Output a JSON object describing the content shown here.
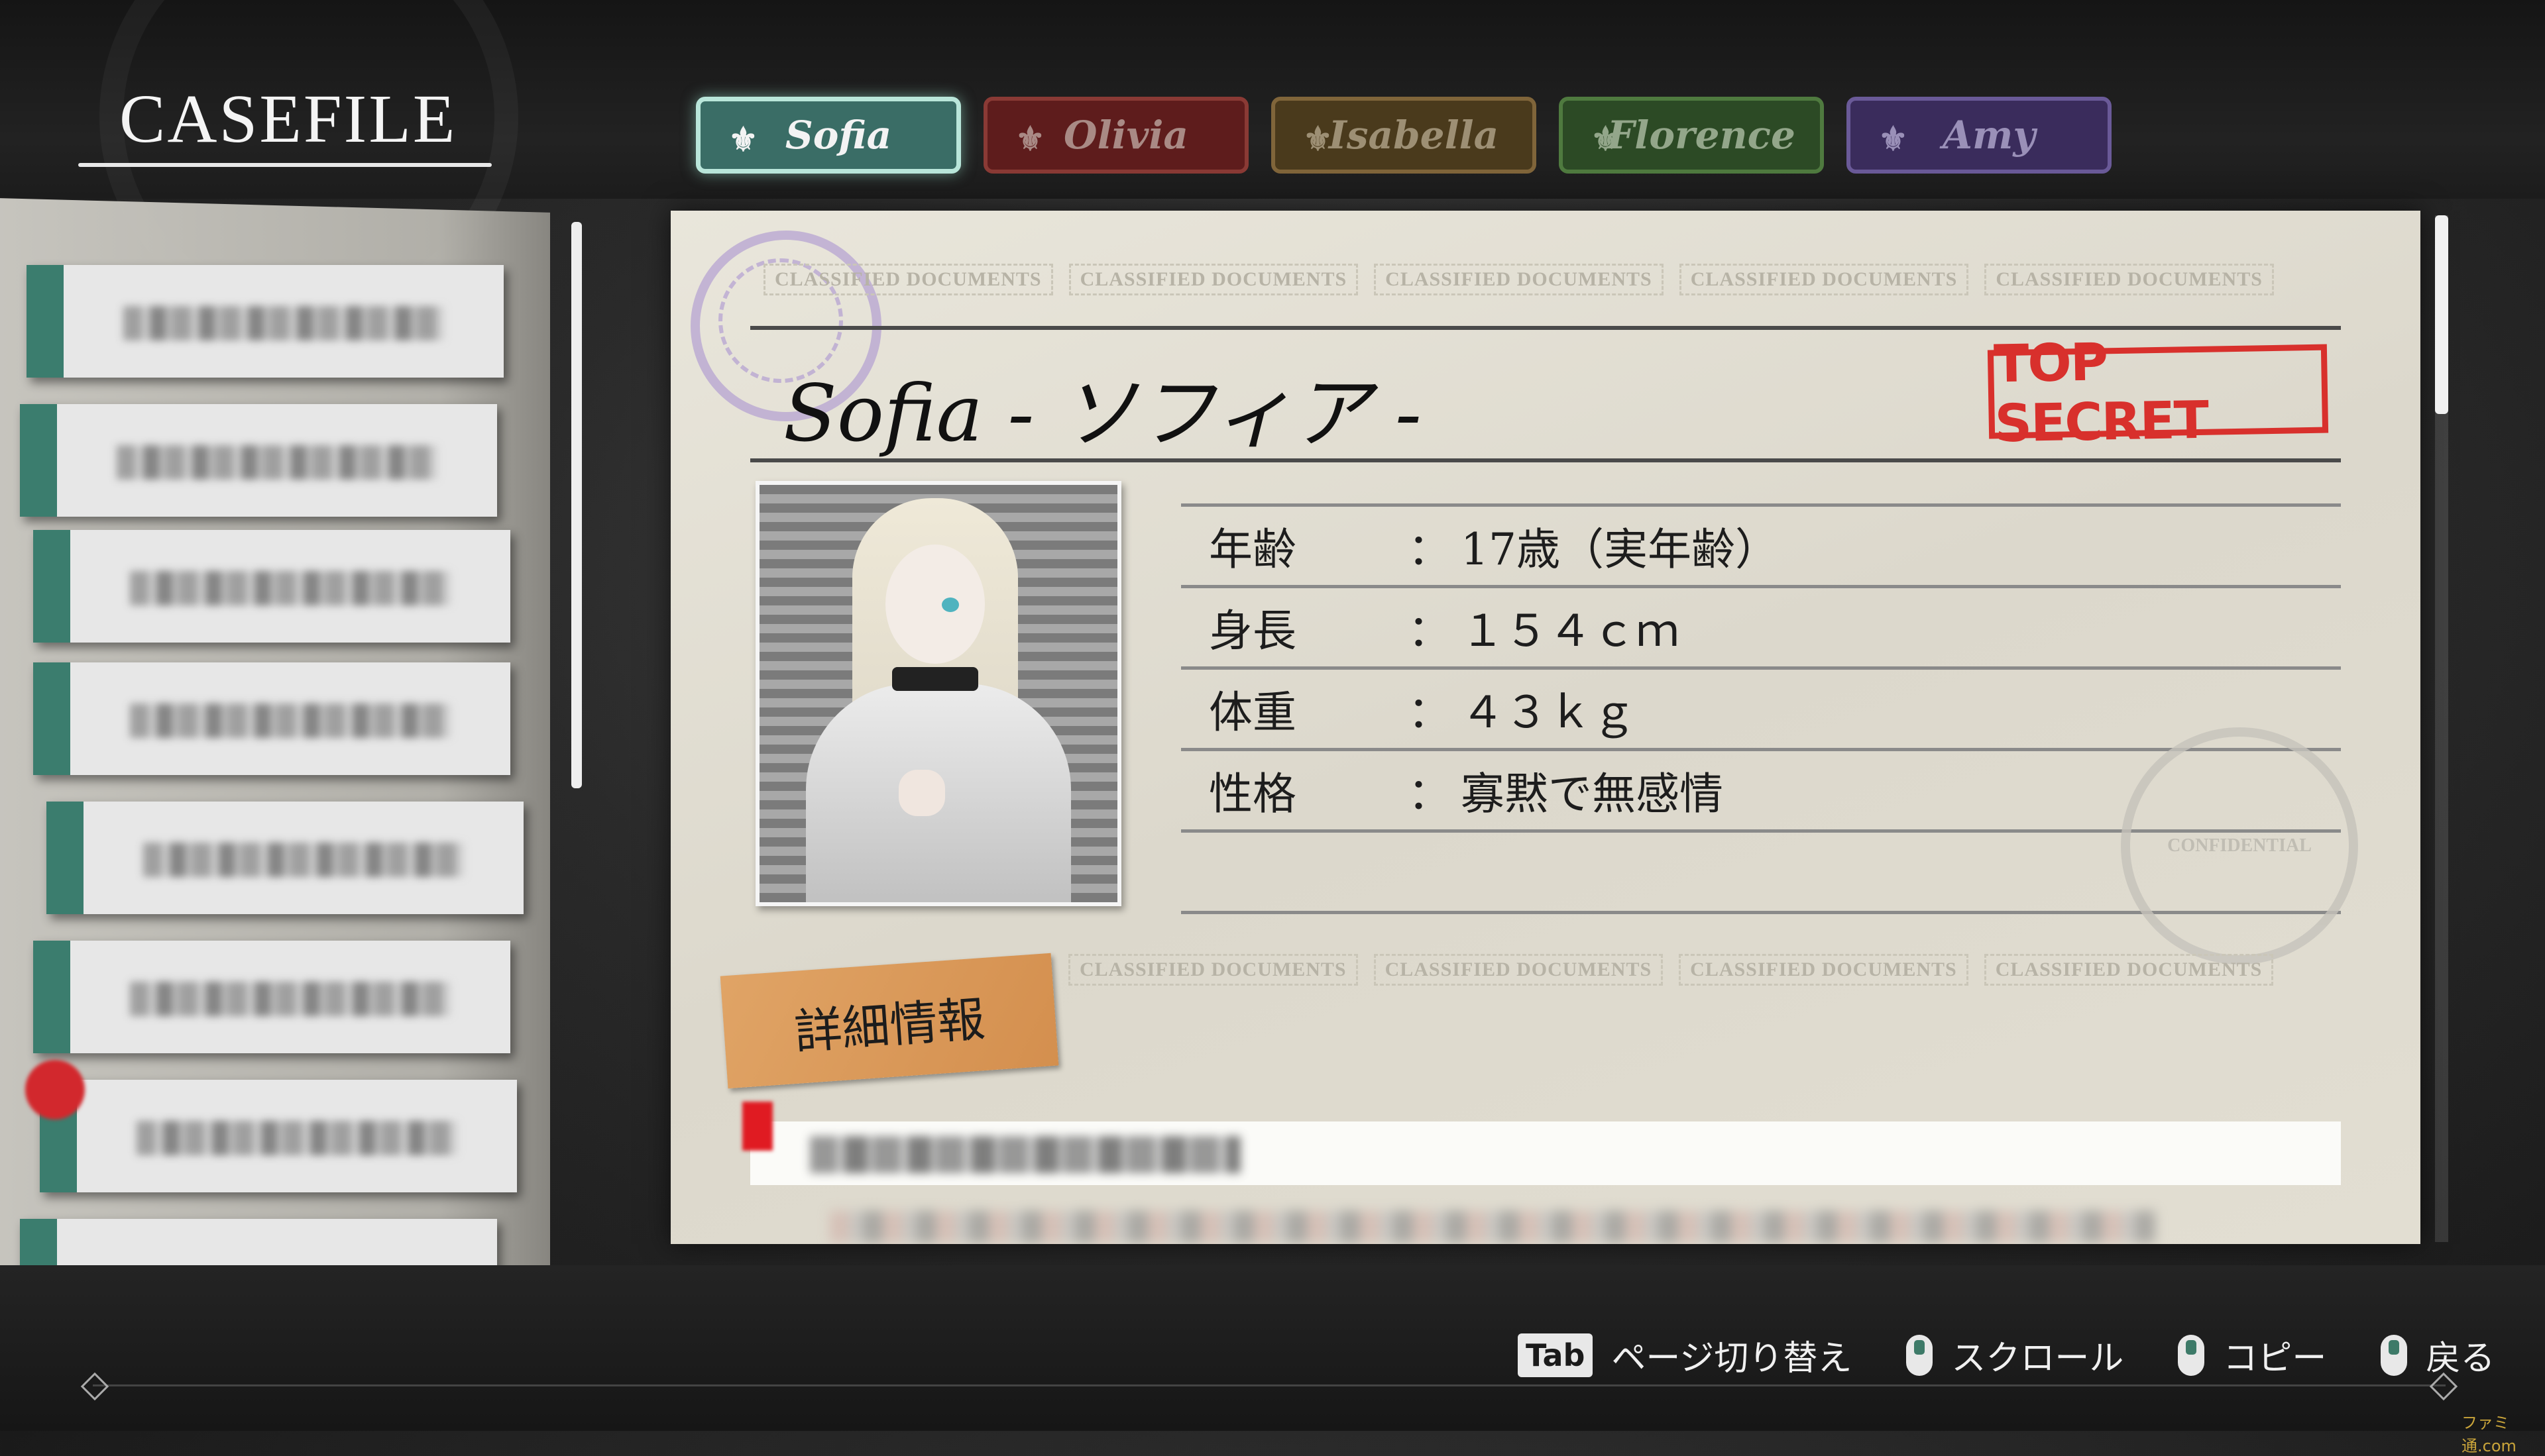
{
  "header": {
    "title": "CASEFILE",
    "tabs": [
      {
        "label": "Sofia",
        "active": true,
        "color": "#3a6d66"
      },
      {
        "label": "Olivia",
        "active": false,
        "color": "#5e1c1c"
      },
      {
        "label": "Isabella",
        "active": false,
        "color": "#4a3a1c"
      },
      {
        "label": "Florence",
        "active": false,
        "color": "#2c4a25"
      },
      {
        "label": "Amy",
        "active": false,
        "color": "#3a2c5c"
      }
    ],
    "tab_icon": "fleur-de-lis-icon"
  },
  "sidebar": {
    "entries_note": "pixelated/blurred entries",
    "entry_count": 8
  },
  "card": {
    "watermark_text": "CLASSIFIED DOCUMENTS",
    "name": "Sofia  - ソフィア -",
    "stamp": "TOP SECRET",
    "stamp_color": "#d8302c",
    "profile": [
      {
        "key": "年齢",
        "sep": "：",
        "value": "17歳（実年齢）"
      },
      {
        "key": "身長",
        "sep": "：",
        "value": "１５４ｃｍ"
      },
      {
        "key": "体重",
        "sep": "：",
        "value": "４３ｋｇ"
      },
      {
        "key": "性格",
        "sep": "：",
        "value": "寡黙で無感情"
      }
    ],
    "confidential_seal": "CONFIDENTIAL",
    "detail_tag": "詳細情報"
  },
  "footer": {
    "hints": [
      {
        "key": "Tab",
        "label": "ページ切り替え"
      },
      {
        "icon": "mouse-wheel-icon",
        "label": "スクロール"
      },
      {
        "icon": "mouse-left-icon",
        "label": "コピー"
      },
      {
        "icon": "mouse-right-icon",
        "label": "戻る"
      }
    ],
    "watermark": "ファミ通.com"
  }
}
